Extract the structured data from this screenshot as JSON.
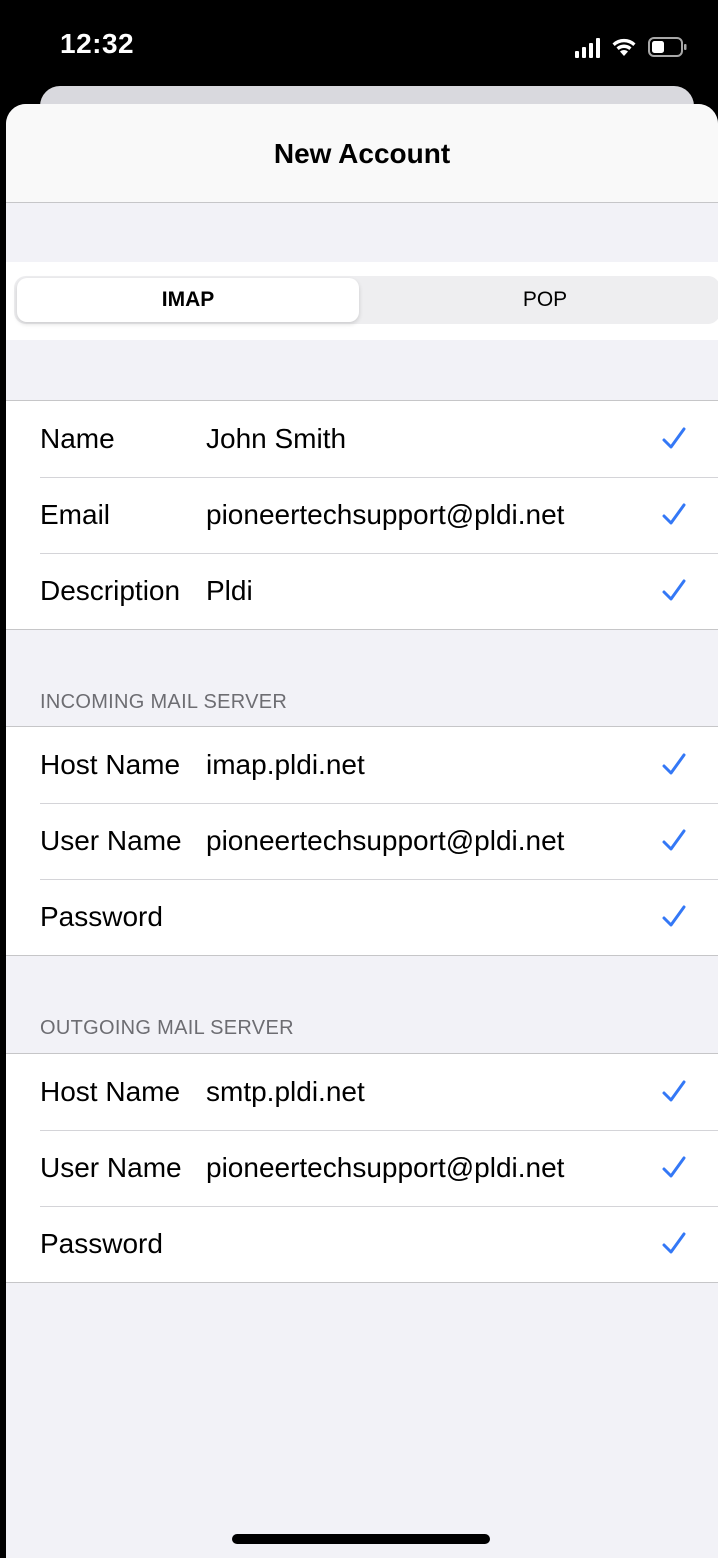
{
  "status_bar": {
    "time": "12:32",
    "icons": [
      "signal-icon",
      "wifi-icon",
      "battery-icon"
    ]
  },
  "nav": {
    "title": "New Account"
  },
  "segmented_control": {
    "options": [
      "IMAP",
      "POP"
    ],
    "selected": "IMAP"
  },
  "account": {
    "rows": [
      {
        "label": "Name",
        "value": "John Smith"
      },
      {
        "label": "Email",
        "value": "pioneertechsupport@pldi.net"
      },
      {
        "label": "Description",
        "value": "Pldi"
      }
    ]
  },
  "incoming": {
    "header": "INCOMING MAIL SERVER",
    "rows": [
      {
        "label": "Host Name",
        "value": "imap.pldi.net"
      },
      {
        "label": "User Name",
        "value": "pioneertechsupport@pldi.net"
      },
      {
        "label": "Password",
        "value": ""
      }
    ]
  },
  "outgoing": {
    "header": "OUTGOING MAIL SERVER",
    "rows": [
      {
        "label": "Host Name",
        "value": "smtp.pldi.net"
      },
      {
        "label": "User Name",
        "value": "pioneertechsupport@pldi.net"
      },
      {
        "label": "Password",
        "value": ""
      }
    ]
  },
  "colors": {
    "accent": "#3478f6",
    "background": "#f2f2f7",
    "separator": "#c6c6c8",
    "section_header": "#6d6d72"
  },
  "check_icon": "checkmark-icon"
}
